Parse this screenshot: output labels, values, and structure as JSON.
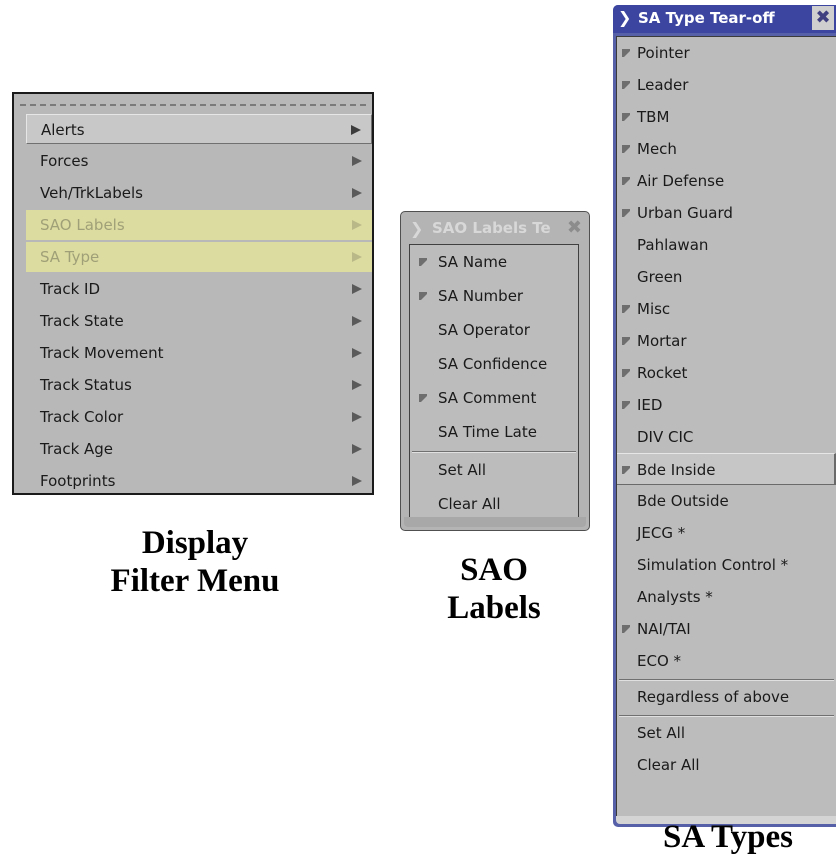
{
  "display_filter_menu": {
    "items": [
      {
        "label": "Alerts",
        "state": "active"
      },
      {
        "label": "Forces",
        "state": "normal"
      },
      {
        "label": "Veh/TrkLabels",
        "state": "normal"
      },
      {
        "label": "SAO Labels",
        "state": "disabled"
      },
      {
        "label": "SA Type",
        "state": "disabled"
      },
      {
        "label": "Track ID",
        "state": "normal"
      },
      {
        "label": "Track State",
        "state": "normal"
      },
      {
        "label": "Track Movement",
        "state": "normal"
      },
      {
        "label": "Track Status",
        "state": "normal"
      },
      {
        "label": "Track Color",
        "state": "normal"
      },
      {
        "label": "Track Age",
        "state": "normal"
      },
      {
        "label": "Footprints",
        "state": "normal"
      }
    ]
  },
  "sao_labels_window": {
    "title": "SAO Labels Te",
    "options": [
      {
        "label": "SA Name",
        "checked": true
      },
      {
        "label": "SA Number",
        "checked": true
      },
      {
        "label": "SA Operator",
        "checked": false
      },
      {
        "label": "SA Confidence",
        "checked": false
      },
      {
        "label": "SA Comment",
        "checked": true
      },
      {
        "label": "SA Time Late",
        "checked": false
      }
    ],
    "actions": [
      "Set All",
      "Clear All"
    ]
  },
  "sa_type_window": {
    "title": "SA Type Tear-off",
    "options": [
      {
        "label": "Pointer",
        "checked": true
      },
      {
        "label": "Leader",
        "checked": true
      },
      {
        "label": "TBM",
        "checked": true
      },
      {
        "label": "Mech",
        "checked": true
      },
      {
        "label": "Air Defense",
        "checked": true
      },
      {
        "label": "Urban Guard",
        "checked": true
      },
      {
        "label": "Pahlawan",
        "checked": false
      },
      {
        "label": "Green",
        "checked": false
      },
      {
        "label": "Misc",
        "checked": true
      },
      {
        "label": "Mortar",
        "checked": true
      },
      {
        "label": "Rocket",
        "checked": true
      },
      {
        "label": "IED",
        "checked": true
      },
      {
        "label": "DIV CIC",
        "checked": false
      },
      {
        "label": "Bde Inside",
        "checked": true,
        "state": "active"
      },
      {
        "label": "Bde Outside",
        "checked": false
      },
      {
        "label": "JECG *",
        "checked": false
      },
      {
        "label": "Simulation Control *",
        "checked": false
      },
      {
        "label": "Analysts *",
        "checked": false
      },
      {
        "label": "NAI/TAI",
        "checked": true
      },
      {
        "label": "ECO *",
        "checked": false
      }
    ],
    "regardless": "Regardless of above",
    "actions": [
      "Set All",
      "Clear All"
    ]
  },
  "captions": {
    "filter_line1": "Display",
    "filter_line2": "Filter Menu",
    "sao_line1": "SAO",
    "sao_line2": "Labels",
    "satypes": "SA Types"
  },
  "icons": {
    "submenu_arrow": "triangle-right-icon",
    "title_chevron": "chevron-down-icon",
    "title_close": "close-icon",
    "check": "check-mark-icon"
  },
  "colors": {
    "menu_bg": "#b8b8b8",
    "disabled_highlight": "#dcdca0",
    "active_titlebar": "#3c46a0"
  }
}
